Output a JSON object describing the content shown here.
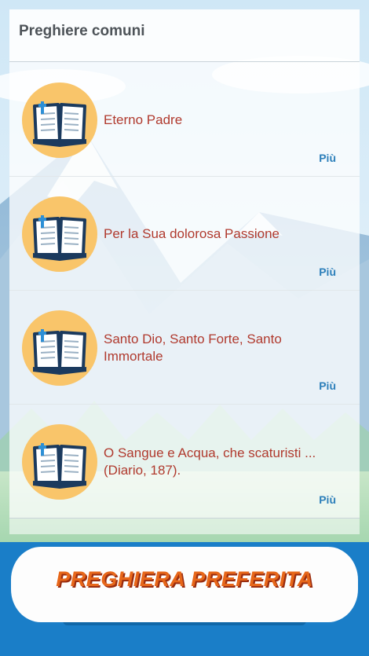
{
  "header": {
    "title": "Preghiere comuni"
  },
  "prayers": [
    {
      "title": "Eterno Padre",
      "more": "Più"
    },
    {
      "title": "Per la Sua dolorosa Passione",
      "more": "Più"
    },
    {
      "title": "Santo Dio, Santo Forte, Santo Immortale",
      "more": "Più"
    },
    {
      "title": "O Sangue e Acqua, che scaturisti ... (Diario, 187).",
      "more": "Più"
    }
  ],
  "banner": {
    "text": "PREGHIERA PREFERITA"
  },
  "icons": {
    "prayer_book": "bible-book-icon"
  },
  "colors": {
    "title_text": "#b03a2e",
    "link": "#2c7fba",
    "icon_circle": "#f9c56a",
    "banner_bg": "#1a7ec8",
    "banner_text": "#e7671a"
  }
}
